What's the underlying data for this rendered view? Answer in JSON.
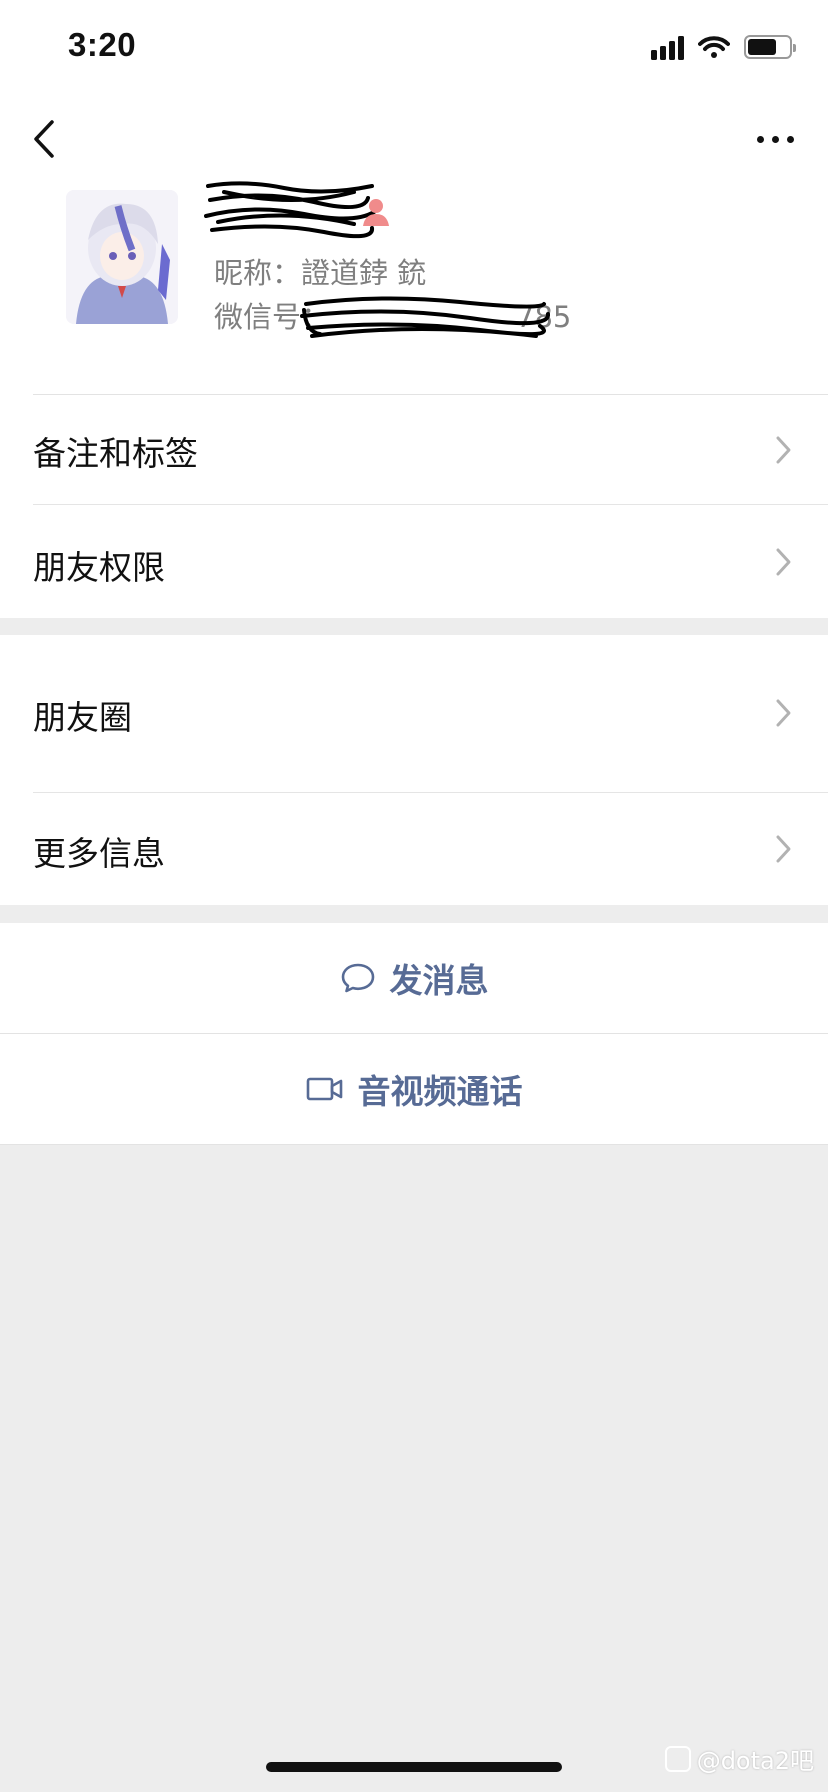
{
  "status_bar": {
    "time": "3:20"
  },
  "profile": {
    "name": "",
    "nickname_label": "昵称：",
    "nickname": "證道鋍 銃",
    "wechat_id_label": "微信号：",
    "wechat_id_partial": "785"
  },
  "menu_group1": [
    {
      "label": "备注和标签"
    },
    {
      "label": "朋友权限"
    }
  ],
  "menu_group2": [
    {
      "label": "朋友圈"
    },
    {
      "label": "更多信息"
    }
  ],
  "actions": {
    "send_message": "发消息",
    "video_call": "音视频通话"
  },
  "watermark": "@dota2吧",
  "colors": {
    "accent_link": "#576b95",
    "background": "#ededed"
  }
}
